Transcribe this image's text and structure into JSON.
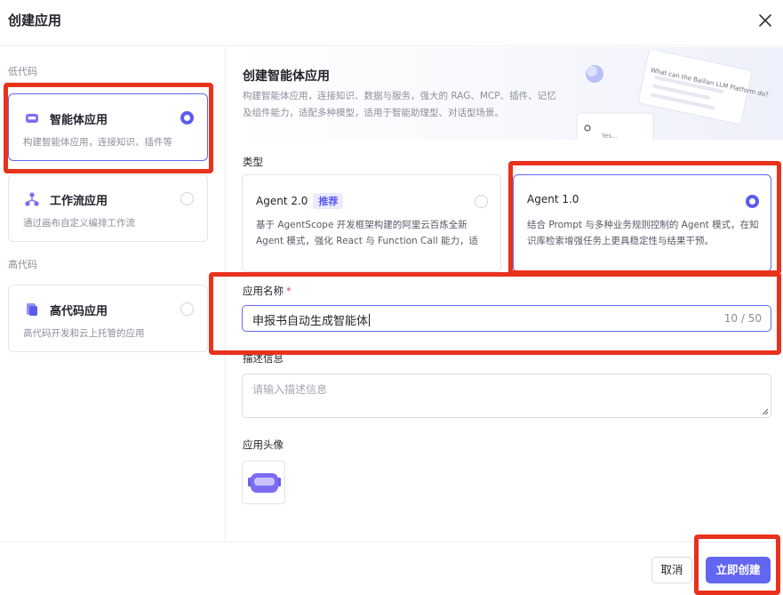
{
  "dialog": {
    "title": "创建应用"
  },
  "sidebar": {
    "low_code_label": "低代码",
    "high_code_label": "高代码",
    "items": [
      {
        "title": "智能体应用",
        "desc": "构建智能体应用，连接知识、插件等",
        "selected": true
      },
      {
        "title": "工作流应用",
        "desc": "通过画布自定义编排工作流",
        "selected": false
      },
      {
        "title": "高代码应用",
        "desc": "高代码开发和云上托管的应用",
        "selected": false
      }
    ]
  },
  "banner": {
    "title": "创建智能体应用",
    "desc": "构建智能体应用，连接知识、数据与服务，强大的 RAG、MCP、插件、记忆及组件能力，适配多种模型，适用于智能助理型、对话型场景。",
    "illus_text": "What can the Bailian LLM Platform do?",
    "illus_small": "Yes..."
  },
  "type": {
    "label": "类型",
    "options": [
      {
        "title": "Agent 2.0",
        "tag": "推荐",
        "desc": "基于 AgentScope 开发框架构建的阿里云百炼全新 Agent 模式，强化 React 与 Function Call 能力，适用...",
        "selected": false
      },
      {
        "title": "Agent 1.0",
        "tag": "",
        "desc": "结合 Prompt 与多种业务规则控制的 Agent 模式，在知识库检索增强任务上更具稳定性与结果干预。",
        "selected": true
      }
    ]
  },
  "name_field": {
    "label": "应用名称",
    "required": "*",
    "value": "申报书自动生成智能体",
    "count": "10 / 50"
  },
  "desc_field": {
    "label": "描述信息",
    "placeholder": "请输入描述信息"
  },
  "avatar_field": {
    "label": "应用头像"
  },
  "footer": {
    "cancel": "取消",
    "create": "立即创建"
  },
  "colors": {
    "accent": "#6366f1",
    "highlight": "#e8321c",
    "radio": "#5b5bf0"
  }
}
